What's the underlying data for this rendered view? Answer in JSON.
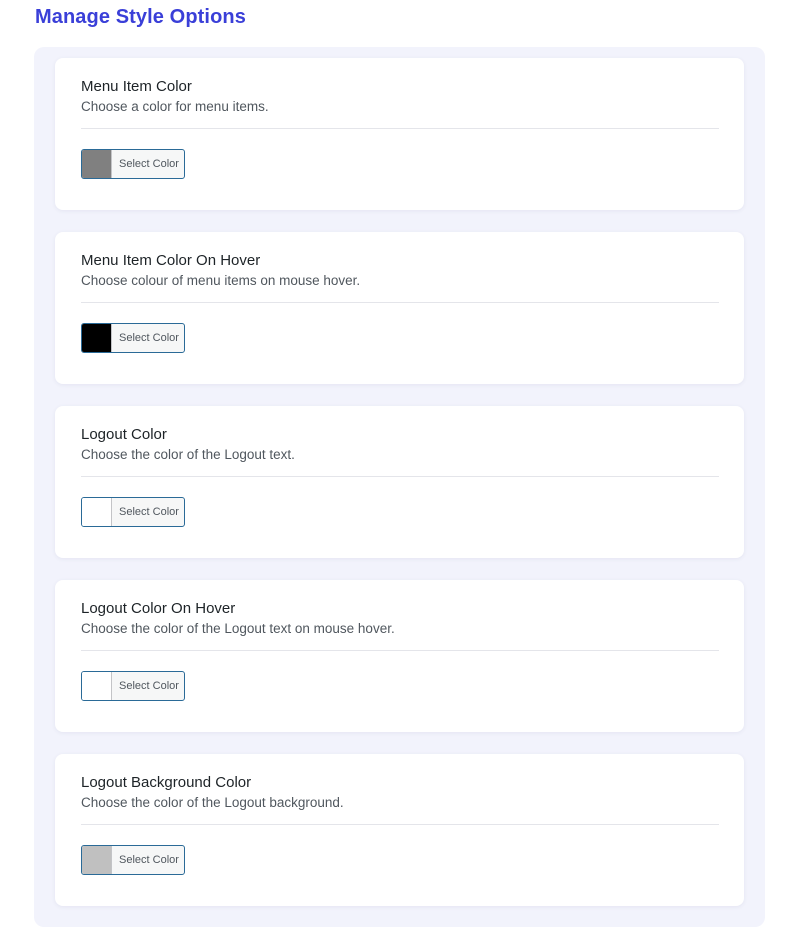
{
  "page": {
    "title": "Manage Style Options"
  },
  "options": [
    {
      "title": "Menu Item Color",
      "description": "Choose a color for menu items.",
      "button_label": "Select Color",
      "swatch_color": "#808080"
    },
    {
      "title": "Menu Item Color On Hover",
      "description": "Choose colour of menu items on mouse hover.",
      "button_label": "Select Color",
      "swatch_color": "#000000"
    },
    {
      "title": "Logout Color",
      "description": "Choose the color of the Logout text.",
      "button_label": "Select Color",
      "swatch_color": "#ffffff"
    },
    {
      "title": "Logout Color On Hover",
      "description": "Choose the color of the Logout text on mouse hover.",
      "button_label": "Select Color",
      "swatch_color": "#ffffff"
    },
    {
      "title": "Logout Background Color",
      "description": "Choose the color of the Logout background.",
      "button_label": "Select Color",
      "swatch_color": "#c0c0c0"
    }
  ],
  "colors": {
    "title": "#3a3fd8",
    "panel_background": "#f2f3fc",
    "picker_border": "#2a6a97"
  }
}
